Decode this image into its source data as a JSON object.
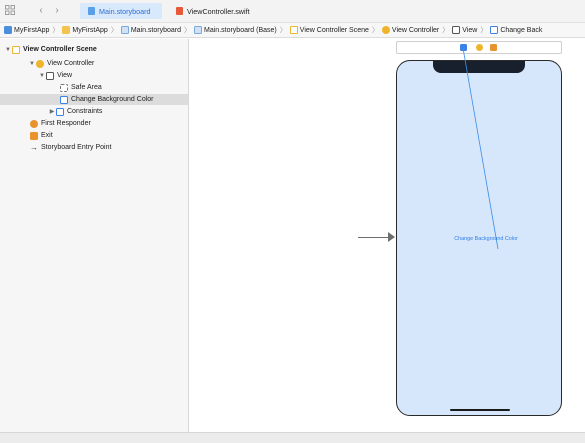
{
  "tabs": [
    {
      "label": "Main.storyboard",
      "active": true
    },
    {
      "label": "ViewController.swift",
      "active": false
    }
  ],
  "toolbar": {
    "grid_icon": "grid-icon",
    "back_icon": "chevron-left-icon",
    "forward_icon": "chevron-right-icon"
  },
  "jumpbar": [
    {
      "label": "MyFirstApp",
      "icon": "project-icon"
    },
    {
      "label": "MyFirstApp",
      "icon": "folder-icon"
    },
    {
      "label": "Main.storyboard",
      "icon": "storyboard-icon"
    },
    {
      "label": "Main.storyboard (Base)",
      "icon": "storyboard-icon"
    },
    {
      "label": "View Controller Scene",
      "icon": "scene-icon"
    },
    {
      "label": "View Controller",
      "icon": "view-controller-icon"
    },
    {
      "label": "View",
      "icon": "view-icon"
    },
    {
      "label": "Change Back",
      "icon": "button-icon"
    }
  ],
  "outline": [
    {
      "label": "View Controller Scene",
      "icon": "scene-icon",
      "disclosure": "▼",
      "bold": true,
      "selected": false
    },
    {
      "label": "View Controller",
      "icon": "view-controller-icon",
      "disclosure": "▼",
      "bold": false,
      "selected": false
    },
    {
      "label": "View",
      "icon": "view-icon",
      "disclosure": "▼",
      "bold": false,
      "selected": false
    },
    {
      "label": "Safe Area",
      "icon": "safe-area-icon",
      "disclosure": "",
      "bold": false,
      "selected": false
    },
    {
      "label": "Change Background Color",
      "icon": "button-icon",
      "disclosure": "",
      "bold": false,
      "selected": true
    },
    {
      "label": "Constraints",
      "icon": "constraints-icon",
      "disclosure": "▶",
      "bold": false,
      "selected": false
    },
    {
      "label": "First Responder",
      "icon": "first-responder-icon",
      "disclosure": "",
      "bold": false,
      "selected": false
    },
    {
      "label": "Exit",
      "icon": "exit-icon",
      "disclosure": "",
      "bold": false,
      "selected": false
    },
    {
      "label": "Storyboard Entry Point",
      "icon": "entry-arrow-icon",
      "disclosure": "",
      "bold": false,
      "selected": false
    }
  ],
  "canvas": {
    "button_label": "Change Background Color"
  },
  "colors": {
    "accent": "#2f7fe6",
    "phone_bg": "#d6e6fb",
    "selection": "#dcdcdc",
    "scene_icon": "#f0b42c",
    "button_icon": "#3b82e6",
    "exit_icon": "#e8932e"
  }
}
